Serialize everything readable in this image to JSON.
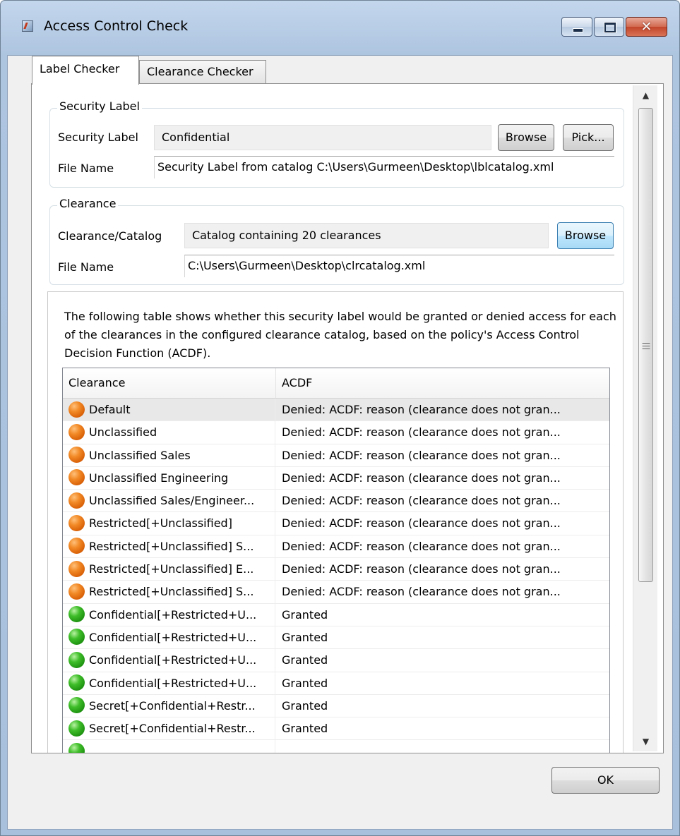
{
  "window": {
    "title": "Access Control Check",
    "close_glyph": "✕"
  },
  "tabs": [
    {
      "label": "Label Checker",
      "active": true
    },
    {
      "label": "Clearance Checker",
      "active": false
    }
  ],
  "security_label_group": {
    "title": "Security Label",
    "label_caption": "Security Label",
    "label_value": "Confidential",
    "browse": "Browse",
    "pick": "Pick...",
    "file_caption": "File Name",
    "file_value": "Security Label from catalog C:\\Users\\Gurmeen\\Desktop\\lblcatalog.xml"
  },
  "clearance_group": {
    "title": "Clearance",
    "caption": "Clearance/Catalog",
    "value": "Catalog containing 20 clearances",
    "browse": "Browse",
    "file_caption": "File Name",
    "file_value": "C:\\Users\\Gurmeen\\Desktop\\clrcatalog.xml"
  },
  "results": {
    "description": "The following table shows whether this security label would be granted or denied access for each of the clearances in the configured clearance catalog, based on the policy's Access Control Decision Function (ACDF).",
    "columns": [
      "Clearance",
      "ACDF"
    ],
    "rows": [
      {
        "clearance": "Default",
        "acdf": "Denied: ACDF: reason (clearance does not gran...",
        "status": "denied",
        "icon": "orange-status-icon"
      },
      {
        "clearance": "Unclassified",
        "acdf": "Denied: ACDF: reason (clearance does not gran...",
        "status": "denied",
        "icon": "orange-status-icon"
      },
      {
        "clearance": "Unclassified Sales",
        "acdf": "Denied: ACDF: reason (clearance does not gran...",
        "status": "denied",
        "icon": "orange-status-icon"
      },
      {
        "clearance": "Unclassified Engineering",
        "acdf": "Denied: ACDF: reason (clearance does not gran...",
        "status": "denied",
        "icon": "orange-status-icon"
      },
      {
        "clearance": "Unclassified Sales/Engineer...",
        "acdf": "Denied: ACDF: reason (clearance does not gran...",
        "status": "denied",
        "icon": "orange-status-icon"
      },
      {
        "clearance": "Restricted[+Unclassified]",
        "acdf": "Denied: ACDF: reason (clearance does not gran...",
        "status": "denied",
        "icon": "orange-status-icon"
      },
      {
        "clearance": "Restricted[+Unclassified] S...",
        "acdf": "Denied: ACDF: reason (clearance does not gran...",
        "status": "denied",
        "icon": "orange-status-icon"
      },
      {
        "clearance": "Restricted[+Unclassified] E...",
        "acdf": "Denied: ACDF: reason (clearance does not gran...",
        "status": "denied",
        "icon": "orange-status-icon"
      },
      {
        "clearance": "Restricted[+Unclassified] S...",
        "acdf": "Denied: ACDF: reason (clearance does not gran...",
        "status": "denied",
        "icon": "orange-status-icon"
      },
      {
        "clearance": "Confidential[+Restricted+U...",
        "acdf": "Granted",
        "status": "granted",
        "icon": "green-status-icon"
      },
      {
        "clearance": "Confidential[+Restricted+U...",
        "acdf": "Granted",
        "status": "granted",
        "icon": "green-status-icon"
      },
      {
        "clearance": "Confidential[+Restricted+U...",
        "acdf": "Granted",
        "status": "granted",
        "icon": "green-status-icon"
      },
      {
        "clearance": "Confidential[+Restricted+U...",
        "acdf": "Granted",
        "status": "granted",
        "icon": "green-status-icon"
      },
      {
        "clearance": "Secret[+Confidential+Restr...",
        "acdf": "Granted",
        "status": "granted",
        "icon": "green-status-icon"
      },
      {
        "clearance": "Secret[+Confidential+Restr...",
        "acdf": "Granted",
        "status": "granted",
        "icon": "green-status-icon"
      },
      {
        "clearance": "",
        "acdf": "",
        "status": "granted",
        "icon": "green-status-icon"
      }
    ]
  },
  "buttons": {
    "ok": "OK"
  },
  "colors": {
    "denied": "#f28a27",
    "granted": "#3fbe29",
    "selected_row": "#e8e8e8"
  }
}
